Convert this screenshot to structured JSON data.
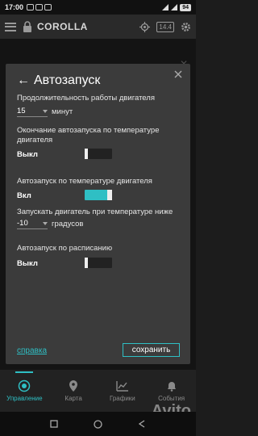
{
  "status_bar": {
    "time": "17:00",
    "battery": "94"
  },
  "app_bar": {
    "title": "COROLLA",
    "voltage": "14.4"
  },
  "dialog": {
    "title": "Автозапуск",
    "duration_label": "Продолжительность работы двигателя",
    "duration_value": "15",
    "duration_unit": "минут",
    "temp_stop_label": "Окончание автозапуска по температуре двигателя",
    "temp_stop_value": "Выкл",
    "temp_stop_on": false,
    "temp_start_label": "Автозапуск по температуре двигателя",
    "temp_start_value": "Вкл",
    "temp_start_on": true,
    "threshold_label": "Запускать двигатель при температуре ниже",
    "threshold_value": "-10",
    "threshold_unit": "градусов",
    "schedule_label": "Автозапуск по расписанию",
    "schedule_value": "Выкл",
    "schedule_on": false,
    "help_link": "справка",
    "save_button": "сохранить"
  },
  "bottom_nav": [
    {
      "label": "Управление",
      "icon": "control-icon",
      "active": true
    },
    {
      "label": "Карта",
      "icon": "map-pin-icon",
      "active": false
    },
    {
      "label": "Графики",
      "icon": "chart-icon",
      "active": false
    },
    {
      "label": "События",
      "icon": "bell-icon",
      "active": false
    }
  ],
  "watermark": "Avito",
  "colors": {
    "accent": "#2fbfc4",
    "dialog_bg": "#3b3b3b",
    "app_bg": "#1b1b1b"
  }
}
